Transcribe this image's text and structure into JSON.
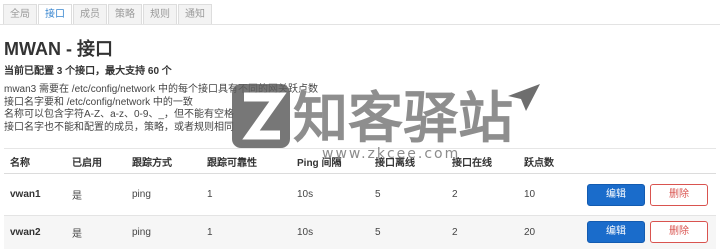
{
  "tabs": [
    {
      "label": "全局",
      "active": false
    },
    {
      "label": "接口",
      "active": true
    },
    {
      "label": "成员",
      "active": false
    },
    {
      "label": "策略",
      "active": false
    },
    {
      "label": "规则",
      "active": false
    },
    {
      "label": "通知",
      "active": false
    }
  ],
  "page": {
    "title": "MWAN - 接口",
    "summary": "当前已配置 3 个接口，最大支持 60 个",
    "notes": [
      "mwan3 需要在 /etc/config/network 中的每个接口具有不同的网关跃点数",
      "接口名字要和 /etc/config/network 中的一致",
      "名称可以包含字符A-Z、a-z、0-9、_，但不能有空格",
      "接口名字也不能和配置的成员，策略，或者规则相同"
    ]
  },
  "table": {
    "headers": [
      "名称",
      "已启用",
      "跟踪方式",
      "跟踪可靠性",
      "Ping 间隔",
      "接口离线",
      "接口在线",
      "跃点数"
    ],
    "rows": [
      {
        "name": "vwan1",
        "enabled": "是",
        "track_method": "ping",
        "track_reliability": "1",
        "ping_interval": "10s",
        "interface_down": "5",
        "interface_up": "2",
        "metric": "10"
      },
      {
        "name": "vwan2",
        "enabled": "是",
        "track_method": "ping",
        "track_reliability": "1",
        "ping_interval": "10s",
        "interface_down": "5",
        "interface_up": "2",
        "metric": "20"
      }
    ],
    "edit_label": "编辑",
    "delete_label": "删除"
  },
  "watermark": {
    "brand": "知客驿站",
    "url": "www.zkcee.com"
  },
  "colors": {
    "accent": "#3a87d0",
    "edit_button": "#1a6ccb",
    "delete_button": "#d9534f",
    "row_alt": "#f6f6f6"
  }
}
